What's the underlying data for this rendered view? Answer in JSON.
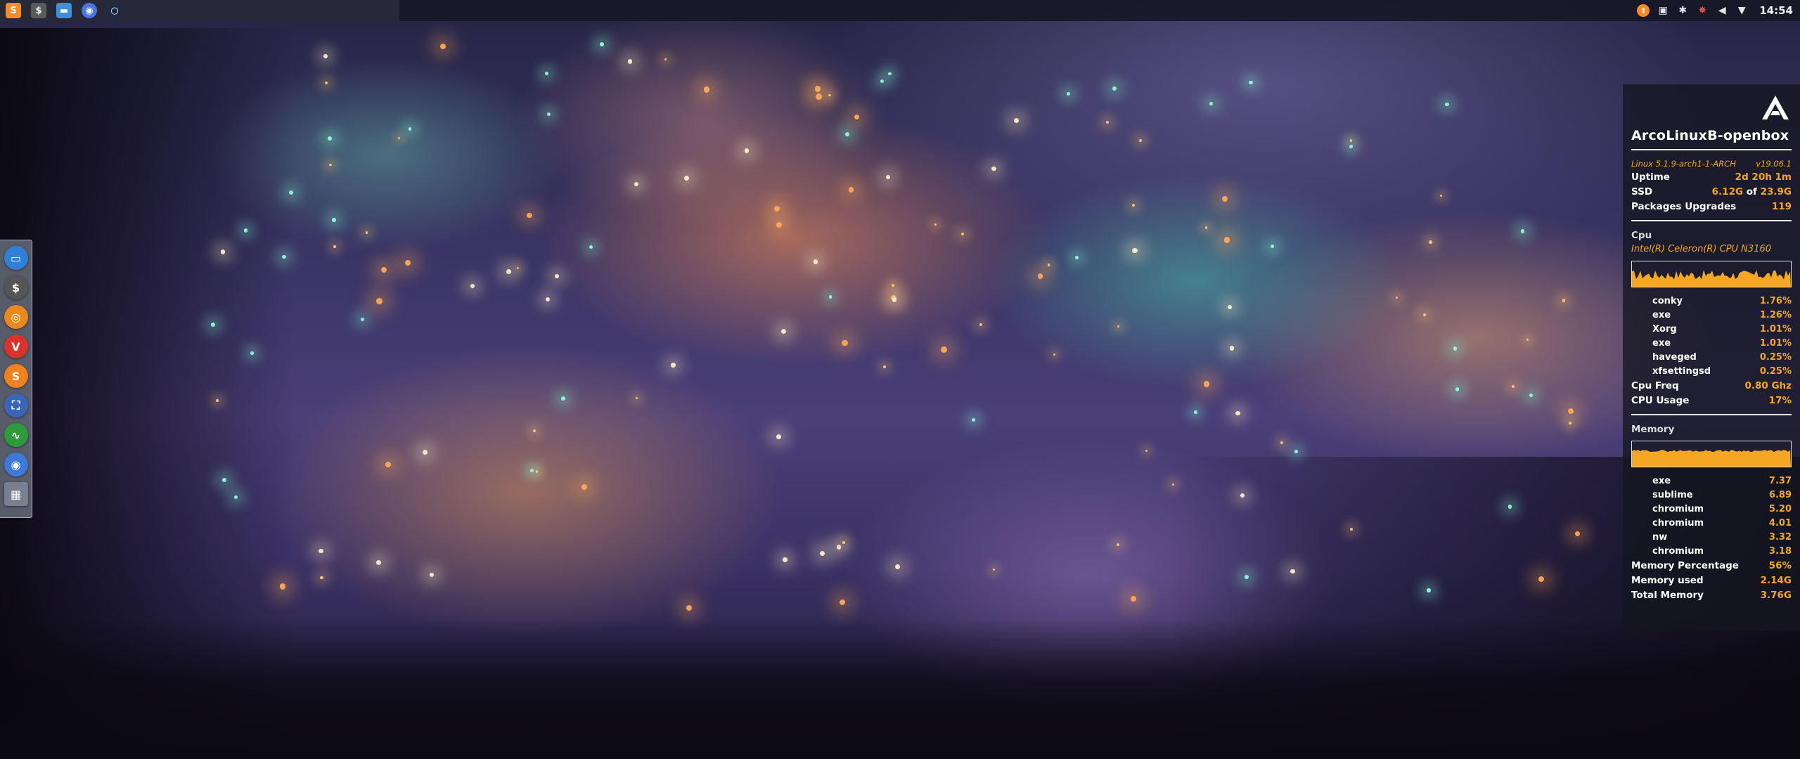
{
  "top_panel": {
    "launchers": [
      {
        "name": "sublime-launcher",
        "glyph": "S",
        "color": "#f28c28"
      },
      {
        "name": "terminal-launcher",
        "glyph": "$",
        "color": "#5a5a5a"
      },
      {
        "name": "file-manager-launcher",
        "glyph": "▬",
        "color": "#3d8fd8"
      },
      {
        "name": "chromium-launcher",
        "glyph": "◉",
        "color": "#4b78e0"
      },
      {
        "name": "dark-launcher",
        "glyph": "○",
        "color": "#1e2a44"
      }
    ],
    "tray": [
      {
        "name": "update-icon",
        "glyph": "⬆"
      },
      {
        "name": "screenshot-icon",
        "glyph": "▣"
      },
      {
        "name": "bluetooth-icon",
        "glyph": "✱"
      },
      {
        "name": "settings-icon",
        "glyph": "✸"
      },
      {
        "name": "volume-icon",
        "glyph": "◀"
      },
      {
        "name": "wifi-icon",
        "glyph": "▼"
      }
    ],
    "clock": "14:54"
  },
  "dock": [
    {
      "name": "file-manager-dock-icon",
      "glyph": "▭",
      "color": "#2f7fd6"
    },
    {
      "name": "terminal-dock-icon",
      "glyph": "$",
      "color": "#555555"
    },
    {
      "name": "ubuntu-dock-icon",
      "glyph": "◎",
      "color": "#e9881d"
    },
    {
      "name": "vivaldi-dock-icon",
      "glyph": "V",
      "color": "#d9342b"
    },
    {
      "name": "sublime-dock-icon",
      "glyph": "S",
      "color": "#f0811e"
    },
    {
      "name": "screenshot-dock-icon",
      "glyph": "⛶",
      "color": "#3a66b8"
    },
    {
      "name": "system-monitor-dock-icon",
      "glyph": "∿",
      "color": "#2f9a3c"
    },
    {
      "name": "chromium-dock-icon",
      "glyph": "◉",
      "color": "#3f79d8"
    },
    {
      "name": "apps-dock-icon",
      "glyph": "▦",
      "color": "#8a94a6"
    }
  ],
  "conky": {
    "hostname": "ArcoLinuxB-openbox",
    "kernel": "Linux 5.1.9-arch1-1-ARCH",
    "version": "v19.06.1",
    "uptime_label": "Uptime",
    "uptime_value": "2d 20h 1m",
    "ssd_label": "SSD",
    "ssd_used": "6.12G",
    "ssd_of": "of",
    "ssd_total": "23.9G",
    "packages_label": "Packages Upgrades",
    "packages_value": "119",
    "cpu_title": "Cpu",
    "cpu_model": "Intel(R) Celeron(R) CPU  N3160",
    "cpu_processes": [
      {
        "name": "conky",
        "value": "1.76%"
      },
      {
        "name": "exe",
        "value": "1.26%"
      },
      {
        "name": "Xorg",
        "value": "1.01%"
      },
      {
        "name": "exe",
        "value": "1.01%"
      },
      {
        "name": "haveged",
        "value": "0.25%"
      },
      {
        "name": "xfsettingsd",
        "value": "0.25%"
      }
    ],
    "cpu_freq_label": "Cpu Freq",
    "cpu_freq_value": "0.80 Ghz",
    "cpu_usage_label": "CPU Usage",
    "cpu_usage_value": "17%",
    "memory_title": "Memory",
    "memory_processes": [
      {
        "name": "exe",
        "value": "7.37"
      },
      {
        "name": "sublime",
        "value": "6.89"
      },
      {
        "name": "chromium",
        "value": "5.20"
      },
      {
        "name": "chromium",
        "value": "4.01"
      },
      {
        "name": "nw",
        "value": "3.32"
      },
      {
        "name": "chromium",
        "value": "3.18"
      }
    ],
    "memory_percentage_label": "Memory Percentage",
    "memory_percentage_value": "56%",
    "memory_used_label": "Memory used",
    "memory_used_value": "2.14G",
    "total_memory_label": "Total Memory",
    "total_memory_value": "3.76G",
    "accent_color": "#f5a623"
  }
}
